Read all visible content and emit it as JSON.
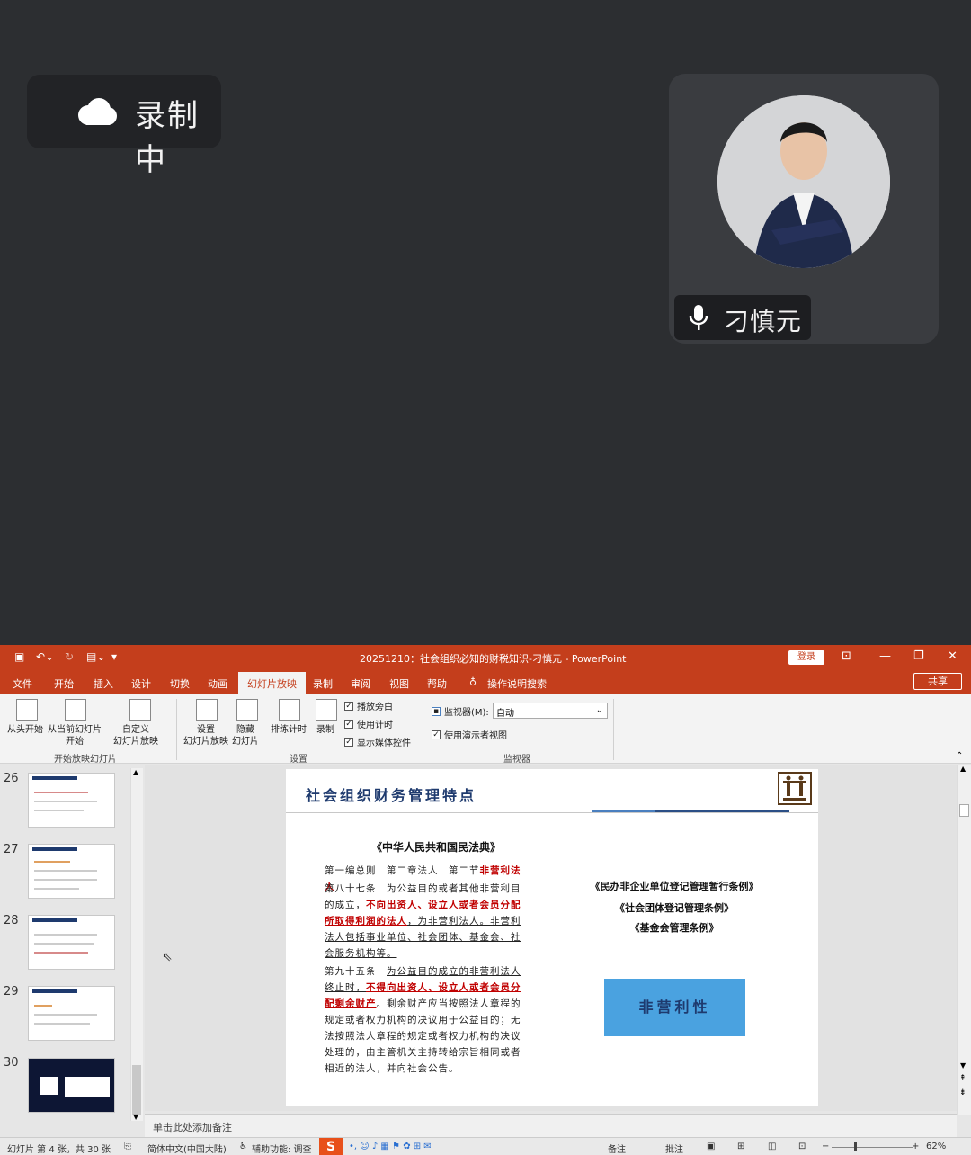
{
  "recording": {
    "label": "录制中",
    "icon": "cloud-icon"
  },
  "presenter": {
    "name": "刁慎元",
    "icon": "microphone-icon"
  },
  "ppt": {
    "window_title": "20251210：社会组织必知的财税知识-刁慎元  -  PowerPoint",
    "login": "登录",
    "share": "共享",
    "tabs": [
      "文件",
      "开始",
      "插入",
      "设计",
      "切换",
      "动画",
      "幻灯片放映",
      "录制",
      "审阅",
      "视图",
      "帮助",
      "操作说明搜索"
    ],
    "active_tab": "幻灯片放映",
    "ribbon": {
      "from_start": "从头开始",
      "from_current": "从当前幻灯片\n开始",
      "custom": "自定义\n幻灯片放映",
      "group_start": "开始放映幻灯片",
      "setup": "设置\n幻灯片放映",
      "hide": "隐藏\n幻灯片",
      "rehearse": "排练计时",
      "record": "录制",
      "chk_narration": "播放旁白",
      "chk_timing": "使用计时",
      "chk_media": "显示媒体控件",
      "group_setup": "设置",
      "monitor_label": "监视器(M):",
      "monitor_value": "自动",
      "presenter_view": "使用演示者视图",
      "group_monitor": "监视器"
    },
    "thumbnails": [
      {
        "num": "26"
      },
      {
        "num": "27"
      },
      {
        "num": "28"
      },
      {
        "num": "29"
      },
      {
        "num": "30"
      }
    ],
    "slide": {
      "title": "社会组织财务管理特点",
      "law_title": "《中华人民共和国民法典》",
      "line1_prefix": "第一编总则　第二章法人　第二节",
      "line1_red": "非营利法人",
      "art87_a": "第八十七条　为公益目的或者其他非营利目的成立，",
      "art87_red": "不向出资人、设立人或者会员分配所取得利润的法人",
      "art87_b": "，为非营利法人。",
      "art87_c": "非营利法人包括事业单位、社会团体、基金会、社会服务机构等。",
      "art95_a": "第九十五条　",
      "art95_b": "为公益目的成立的非营利法人终止时，",
      "art95_red": "不得向出资人、设立人或者会员分配剩余财产",
      "art95_c": "。剩余财产应当按照法人章程的规定或者权力机构的决议用于公益目的；无法按照法人章程的规定或者权力机构的决议处理的，由主管机关主持转给宗旨相同或者相近的法人，并向社会公告。",
      "reg1": "《民办非企业单位登记管理暂行条例》",
      "reg2": "《社会团体登记管理条例》",
      "reg3": "《基金会管理条例》",
      "box": "非营利性"
    },
    "notes_placeholder": "单击此处添加备注",
    "status": {
      "slide_info": "幻灯片 第 4 张，共 30 张",
      "language": "简体中文(中国大陆)",
      "accessibility": "辅助功能: 调查",
      "notes": "备注",
      "comments": "批注",
      "zoom": "62%"
    }
  }
}
